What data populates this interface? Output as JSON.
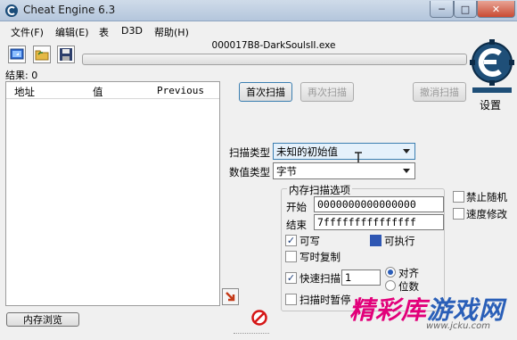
{
  "window": {
    "title": "Cheat Engine 6.3",
    "controls": {
      "minimize": "─",
      "maximize": "□",
      "close": "✕"
    }
  },
  "menu": {
    "items": [
      "文件(F)",
      "编辑(E)",
      "表",
      "D3D",
      "帮助(H)"
    ]
  },
  "toolbar": {
    "icons": [
      "select-process-icon",
      "open-file-icon",
      "save-icon"
    ]
  },
  "process": {
    "name": "000017B8-DarkSoulsII.exe",
    "progress": 0
  },
  "results": {
    "label": "结果: 0",
    "columns": [
      "地址",
      "值",
      "Previous"
    ]
  },
  "scan_buttons": {
    "first_scan": "首次扫描",
    "next_scan": "再次扫描",
    "undo_scan": "撤消扫描"
  },
  "settings_label": "设置",
  "scan_type": {
    "label": "扫描类型",
    "value": "未知的初始值"
  },
  "value_type": {
    "label": "数值类型",
    "value": "字节"
  },
  "memory_options": {
    "title": "内存扫描选项",
    "start_label": "开始",
    "start_value": "0000000000000000",
    "stop_label": "结束",
    "stop_value": "7fffffffffffffff",
    "writable": {
      "label": "可写",
      "checked": true
    },
    "executable": {
      "label": "可执行",
      "checked": true
    },
    "copy_on_write": {
      "label": "写时复制",
      "checked": false
    },
    "fast_scan": {
      "label": "快速扫描",
      "checked": true,
      "value": "1"
    },
    "alignment": {
      "label": "对齐",
      "selected": true
    },
    "last_digits": {
      "label": "位数",
      "selected": false
    },
    "pause_scan": {
      "label": "扫描时暂停",
      "checked": false
    }
  },
  "side_options": {
    "disable_random": {
      "label": "禁止随机",
      "checked": false
    },
    "speedhack": {
      "label": "速度修改",
      "checked": false
    }
  },
  "bottom": {
    "memory_view": "内存浏览"
  },
  "watermark": {
    "text_part1": "精彩库",
    "text_part2": "游戏网",
    "url": "www.jcku.com"
  }
}
